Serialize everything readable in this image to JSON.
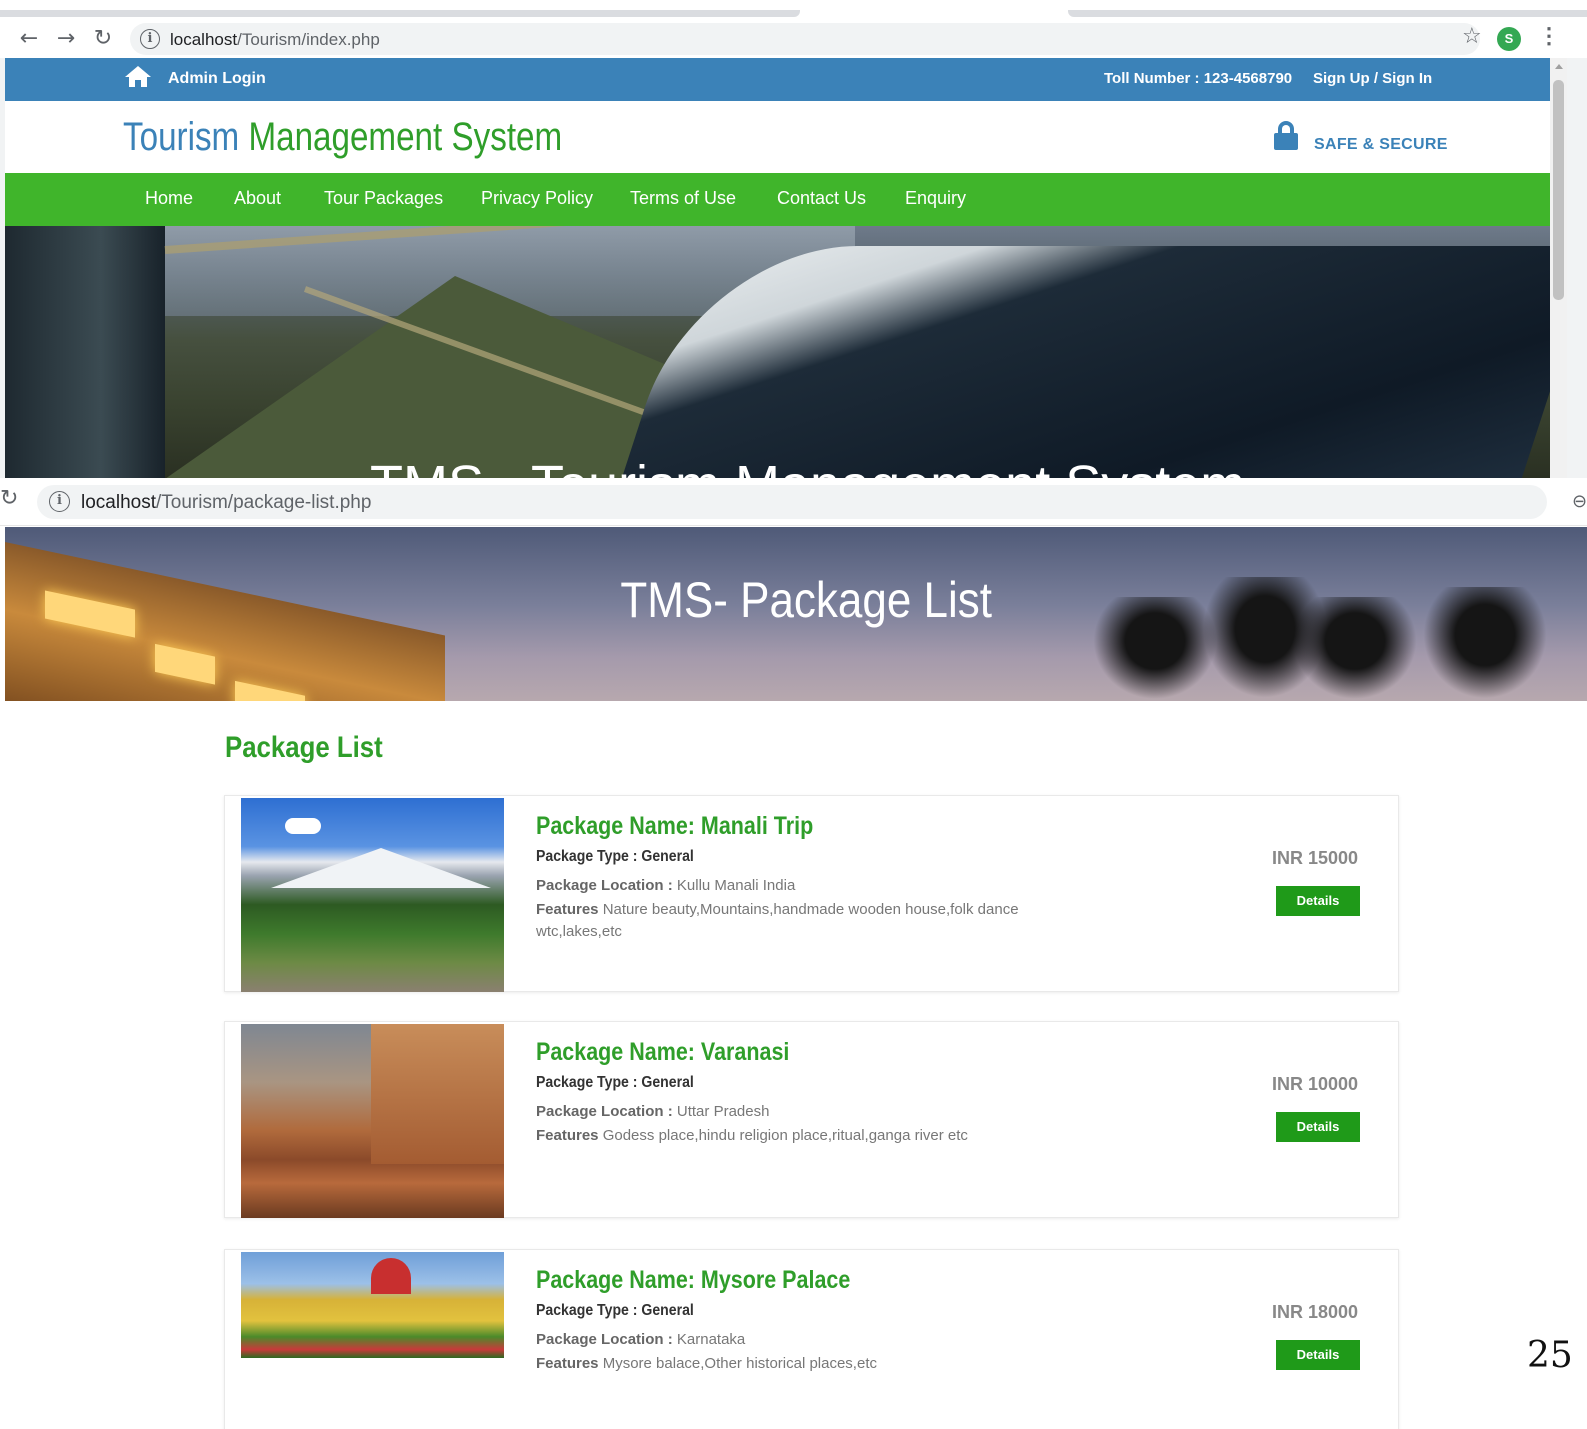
{
  "browser_top": {
    "url_host": "localhost",
    "url_path": "/Tourism/index.php",
    "profile_initial": "S"
  },
  "site": {
    "admin_login": "Admin Login",
    "toll_number": "Toll Number : 123-4568790",
    "signup": "Sign Up / Sign In",
    "brand_part1": "Tourism",
    "brand_part2": "Management System",
    "safe_secure": "SAFE & SECURE",
    "nav": [
      "Home",
      "About",
      "Tour Packages",
      "Privacy Policy",
      "Terms of Use",
      "Contact Us",
      "Enquiry"
    ],
    "hero_text": "TMS - Tourism Management System",
    "colors": {
      "blue": "#3b82b8",
      "green": "#40b52b",
      "dark_green": "#2f9e2a"
    }
  },
  "browser_bottom": {
    "url_host": "localhost",
    "url_path": "/Tourism/package-list.php"
  },
  "package_page": {
    "banner_title": "TMS- Package List",
    "section_title": "Package List",
    "packages": [
      {
        "name": "Package Name: Manali Trip",
        "type": "Package Type : General",
        "location_label": "Package Location :",
        "location": "Kullu Manali India",
        "features_label": "Features",
        "features": "Nature beauty,Mountains,handmade wooden house,folk dance wtc,lakes,etc",
        "price": "INR 15000",
        "details_label": "Details"
      },
      {
        "name": "Package Name: Varanasi",
        "type": "Package Type : General",
        "location_label": "Package Location :",
        "location": "Uttar Pradesh",
        "features_label": "Features",
        "features": "Godess place,hindu religion place,ritual,ganga river etc",
        "price": "INR 10000",
        "details_label": "Details"
      },
      {
        "name": "Package Name: Mysore Palace",
        "type": "Package Type : General",
        "location_label": "Package Location :",
        "location": "Karnataka",
        "features_label": "Features",
        "features": "Mysore balace,Other historical places,etc",
        "price": "INR 18000",
        "details_label": "Details"
      }
    ]
  },
  "page_number": "25"
}
